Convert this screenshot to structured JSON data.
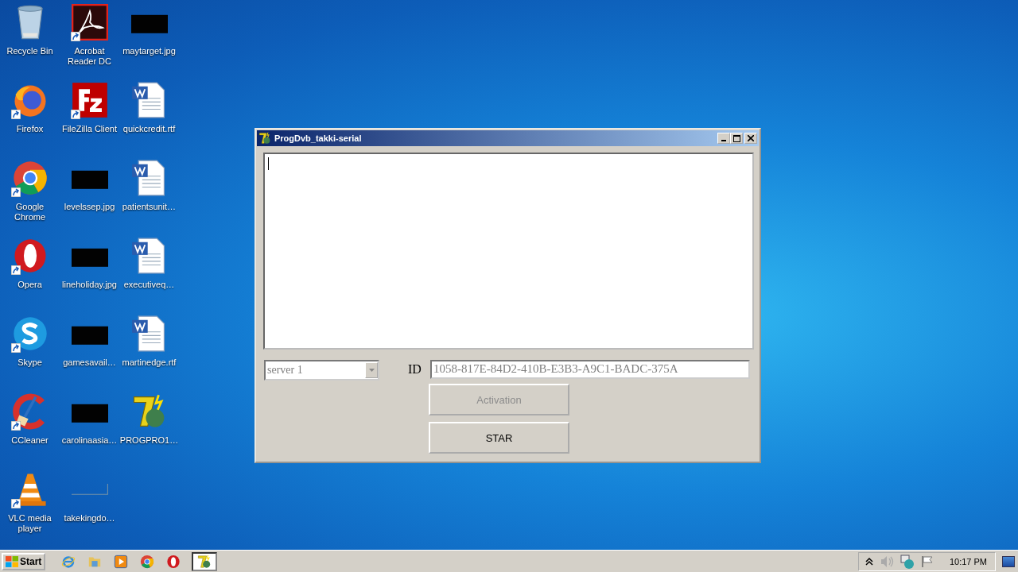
{
  "desktop": {
    "icons": [
      {
        "label": "Recycle Bin",
        "kind": "recycle-bin",
        "shortcut": false
      },
      {
        "label": "Firefox",
        "kind": "firefox",
        "shortcut": true
      },
      {
        "label": "Google Chrome",
        "kind": "chrome",
        "shortcut": true
      },
      {
        "label": "Opera",
        "kind": "opera",
        "shortcut": true
      },
      {
        "label": "Skype",
        "kind": "skype",
        "shortcut": true
      },
      {
        "label": "CCleaner",
        "kind": "ccleaner",
        "shortcut": true
      },
      {
        "label": "VLC media player",
        "kind": "vlc",
        "shortcut": true
      },
      {
        "label": "Acrobat Reader DC",
        "kind": "acrobat",
        "shortcut": true
      },
      {
        "label": "FileZilla Client",
        "kind": "filezilla",
        "shortcut": true
      },
      {
        "label": "levelssep.jpg",
        "kind": "dark-image",
        "shortcut": false
      },
      {
        "label": "lineholiday.jpg",
        "kind": "dark-image",
        "shortcut": false
      },
      {
        "label": "gamesavail…",
        "kind": "dark-image",
        "shortcut": false
      },
      {
        "label": "carolinaasia…",
        "kind": "dark-image",
        "shortcut": false
      },
      {
        "label": "takekingdo…",
        "kind": "blank-image",
        "shortcut": false
      },
      {
        "label": "maytarget.jpg",
        "kind": "dark-image",
        "shortcut": false
      },
      {
        "label": "quickcredit.rtf",
        "kind": "word-doc",
        "shortcut": false
      },
      {
        "label": "patientsunit…",
        "kind": "word-doc",
        "shortcut": false
      },
      {
        "label": "executiveq…",
        "kind": "word-doc",
        "shortcut": false
      },
      {
        "label": "martinedge.rtf",
        "kind": "word-doc",
        "shortcut": false
      },
      {
        "label": "PROGPRO1…",
        "kind": "progdvb",
        "shortcut": false
      }
    ]
  },
  "window": {
    "title": "ProgDvb_takki-serial",
    "text_area": {
      "focused": true
    },
    "server_select": {
      "value": "server 1",
      "disabled": true
    },
    "id_label": "ID",
    "id_field": {
      "value": "1058-817E-84D2-410B-E3B3-A9C1-BADC-375A",
      "disabled": true
    },
    "buttons": [
      {
        "label": "Activation",
        "disabled": true
      },
      {
        "label": "STAR",
        "disabled": false
      }
    ]
  },
  "taskbar": {
    "start": "Start",
    "pinned": [
      {
        "kind": "ie"
      },
      {
        "kind": "explorer"
      },
      {
        "kind": "media-player"
      },
      {
        "kind": "chrome"
      },
      {
        "kind": "opera"
      }
    ],
    "tasks": [
      {
        "kind": "progdvb",
        "selected": true
      }
    ],
    "tray": [
      {
        "kind": "show-hidden"
      },
      {
        "kind": "speaker"
      },
      {
        "kind": "network"
      },
      {
        "kind": "flag"
      }
    ],
    "clock": "10:17 PM"
  }
}
